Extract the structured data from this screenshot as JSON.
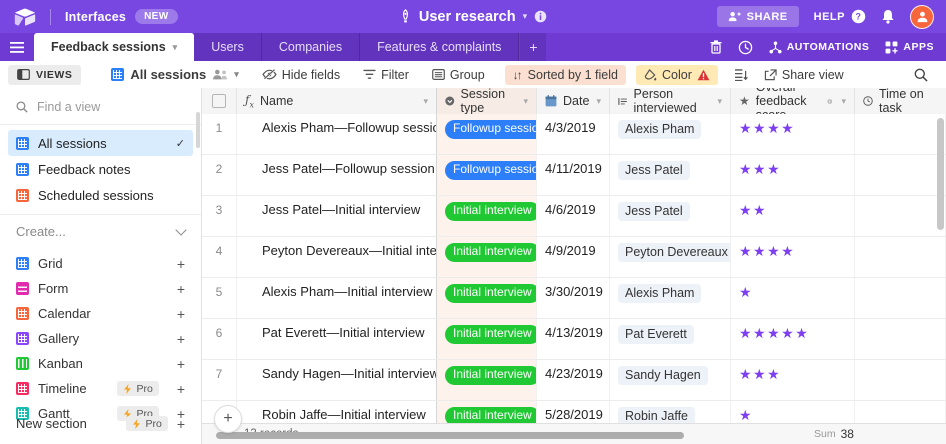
{
  "colors": {
    "topbar": "#7847e1",
    "blue": "#2d7ff9",
    "green": "#20c933",
    "star_purple": "#7e3ff2",
    "selected_view_bg": "#d9ecfd",
    "session_column_tint": "#fdf3ec",
    "sort_chip_bg": "#fbe0d2",
    "color_chip_bg": "#ffeab6",
    "avatar_orange": "#f7653b"
  },
  "topbar": {
    "interfaces_label": "Interfaces",
    "new_badge": "NEW",
    "base_title": "User research",
    "share_label": "SHARE",
    "help_label": "HELP"
  },
  "tabbar": {
    "tabs": [
      {
        "label": "Feedback sessions",
        "active": true
      },
      {
        "label": "Users",
        "active": false
      },
      {
        "label": "Companies",
        "active": false
      },
      {
        "label": "Features & complaints",
        "active": false
      }
    ],
    "add_tab": "+",
    "automations_label": "AUTOMATIONS",
    "apps_label": "APPS"
  },
  "toolbar": {
    "views_label": "VIEWS",
    "current_view": "All sessions",
    "hide_fields_label": "Hide fields",
    "filter_label": "Filter",
    "group_label": "Group",
    "sort_label": "Sorted by 1 field",
    "color_label": "Color",
    "share_view_label": "Share view"
  },
  "sidebar": {
    "find_placeholder": "Find a view",
    "views": [
      {
        "label": "All sessions",
        "type": "grid",
        "color": "#2d7ff9",
        "selected": true
      },
      {
        "label": "Feedback notes",
        "type": "grid",
        "color": "#2d7ff9",
        "selected": false
      },
      {
        "label": "Scheduled sessions",
        "type": "calendar",
        "color": "#f7653b",
        "selected": false
      }
    ],
    "create_label": "Create...",
    "create_items": [
      {
        "label": "Grid",
        "type": "grid",
        "color": "#2d7ff9",
        "pro": false
      },
      {
        "label": "Form",
        "type": "form",
        "color": "#e12aad",
        "pro": false
      },
      {
        "label": "Calendar",
        "type": "calendar",
        "color": "#f7653b",
        "pro": false
      },
      {
        "label": "Gallery",
        "type": "gallery",
        "color": "#8b46ff",
        "pro": false
      },
      {
        "label": "Kanban",
        "type": "kanban",
        "color": "#20c933",
        "pro": false
      },
      {
        "label": "Timeline",
        "type": "timeline",
        "color": "#f82b60",
        "pro": true
      },
      {
        "label": "Gantt",
        "type": "gantt",
        "color": "#17bdae",
        "pro": true
      }
    ],
    "new_section_label": "New section",
    "new_section_pro": true,
    "pro_label": "Pro"
  },
  "table": {
    "columns": [
      {
        "label": "Name",
        "icon": "formula"
      },
      {
        "label": "Session type",
        "icon": "single-select"
      },
      {
        "label": "Date",
        "icon": "calendar"
      },
      {
        "label": "Person interviewed",
        "icon": "linked-record"
      },
      {
        "label": "Overall feedback score",
        "icon": "star"
      },
      {
        "label": "Time on task",
        "icon": "clock"
      }
    ],
    "rows": [
      {
        "num": 1,
        "name": "Alexis Pham—Followup session",
        "session_type": "Followup session",
        "session_color": "#2d7ff9",
        "date": "4/3/2019",
        "person": "Alexis Pham",
        "stars": 4
      },
      {
        "num": 2,
        "name": "Jess Patel—Followup session",
        "session_type": "Followup session",
        "session_color": "#2d7ff9",
        "date": "4/11/2019",
        "person": "Jess Patel",
        "stars": 3
      },
      {
        "num": 3,
        "name": "Jess Patel—Initial interview",
        "session_type": "Initial interview",
        "session_color": "#20c933",
        "date": "4/6/2019",
        "person": "Jess Patel",
        "stars": 2
      },
      {
        "num": 4,
        "name": "Peyton Devereaux—Initial interview",
        "session_type": "Initial interview",
        "session_color": "#20c933",
        "date": "4/9/2019",
        "person": "Peyton Devereaux",
        "stars": 4
      },
      {
        "num": 5,
        "name": "Alexis Pham—Initial interview",
        "session_type": "Initial interview",
        "session_color": "#20c933",
        "date": "3/30/2019",
        "person": "Alexis Pham",
        "stars": 1
      },
      {
        "num": 6,
        "name": "Pat Everett—Initial interview",
        "session_type": "Initial interview",
        "session_color": "#20c933",
        "date": "4/13/2019",
        "person": "Pat Everett",
        "stars": 5
      },
      {
        "num": 7,
        "name": "Sandy Hagen—Initial interview",
        "session_type": "Initial interview",
        "session_color": "#20c933",
        "date": "4/23/2019",
        "person": "Sandy Hagen",
        "stars": 3
      },
      {
        "num": 8,
        "name": "Robin Jaffe—Initial interview",
        "session_type": "Initial interview",
        "session_color": "#20c933",
        "date": "5/28/2019",
        "person": "Robin Jaffe",
        "stars": 1
      }
    ],
    "footer": {
      "records": "13 records",
      "sum_label": "Sum",
      "sum_value": "38"
    }
  }
}
